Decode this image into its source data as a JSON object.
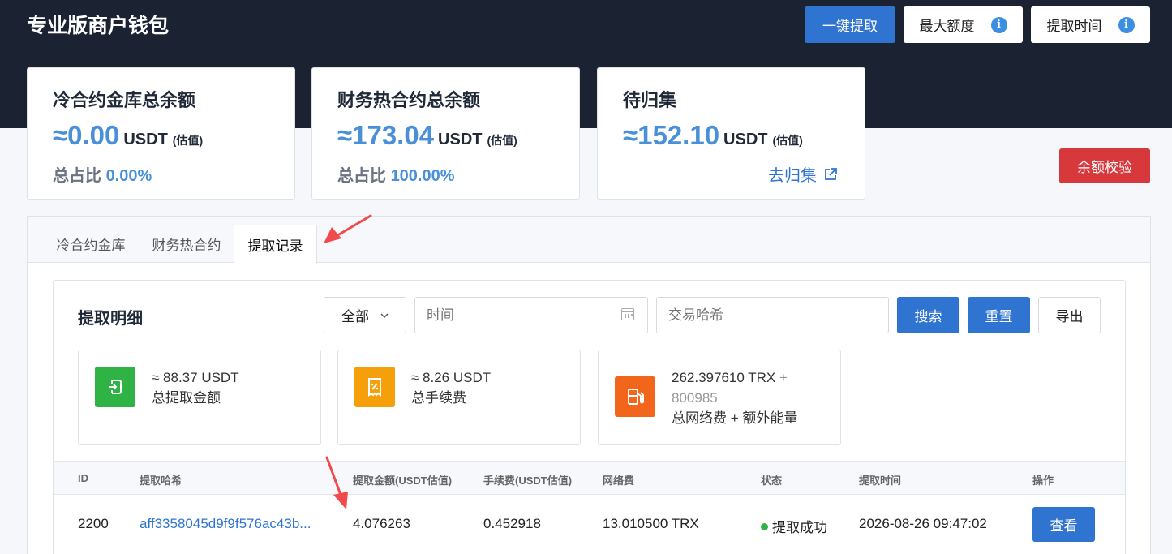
{
  "header": {
    "title": "专业版商户钱包",
    "buttons": {
      "withdraw": "一键提取",
      "max_amount": "最大额度",
      "withdraw_time": "提取时间"
    }
  },
  "cards": [
    {
      "title": "冷合约金库总余额",
      "amount": "≈0.00",
      "unit": "USDT",
      "estimate": "(估值)",
      "ratio_label": "总占比",
      "ratio_value": "0.00%"
    },
    {
      "title": "财务热合约总余额",
      "amount": "≈173.04",
      "unit": "USDT",
      "estimate": "(估值)",
      "ratio_label": "总占比",
      "ratio_value": "100.00%"
    },
    {
      "title": "待归集",
      "amount": "≈152.10",
      "unit": "USDT",
      "estimate": "(估值)",
      "link": "去归集"
    }
  ],
  "verify_button": "余额校验",
  "tabs": [
    "冷合约金库",
    "财务热合约",
    "提取记录"
  ],
  "detail": {
    "title": "提取明细",
    "filter_select": "全部",
    "time_placeholder": "时间",
    "hash_placeholder": "交易哈希",
    "search": "搜索",
    "reset": "重置",
    "export": "导出"
  },
  "summary": [
    {
      "value": "≈ 88.37 USDT",
      "label": "总提取金额"
    },
    {
      "value": "≈ 8.26 USDT",
      "label": "总手续费"
    },
    {
      "value_main": "262.397610 TRX",
      "plus": "+",
      "value_extra": "800985",
      "label": "总网络费 + 额外能量"
    }
  ],
  "table": {
    "headers": [
      "ID",
      "提取哈希",
      "提取金额(USDT估值)",
      "手续费(USDT估值)",
      "网络费",
      "状态",
      "提取时间",
      "操作"
    ],
    "rows": [
      {
        "id": "2200",
        "hash": "aff3358045d9f9f576ac43b...",
        "amount": "4.076263",
        "fee": "0.452918",
        "network_fee": "13.010500 TRX",
        "status": "提取成功",
        "time": "2026-08-26 09:47:02",
        "action": "查看"
      }
    ]
  },
  "colors": {
    "accent": "#2f74d0",
    "header_bg": "#1b2333",
    "danger": "#d6383c",
    "success": "#2fb344",
    "warning": "#f5a00b",
    "orange": "#f2661c",
    "annotation": "#f04a4a"
  }
}
